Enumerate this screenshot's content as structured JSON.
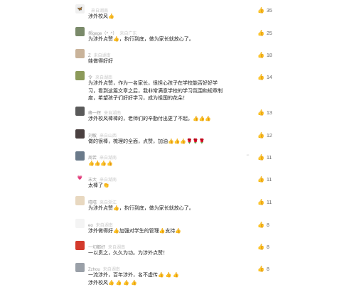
{
  "comments": [
    {
      "avatar": "avatar-butterfly",
      "avatar_color": "#f0f0f0",
      "avatar_icon": "🦋",
      "username": "",
      "location": "来自湖南",
      "text": "涉外校风👍",
      "likes": "35"
    },
    {
      "avatar": "avatar-person",
      "avatar_color": "#7a8a6a",
      "avatar_icon": "",
      "username": "郝gege（^_^）",
      "location": "来自广东",
      "text": "为涉外点赞👍，执行到底，做为家长就放心了。",
      "likes": "25"
    },
    {
      "avatar": "avatar-baby",
      "avatar_color": "#c9b39a",
      "avatar_icon": "",
      "username": "Z",
      "location": "来自湖南",
      "text": "娃做得好好",
      "likes": "18"
    },
    {
      "avatar": "avatar-flower",
      "avatar_color": "#8c9a5a",
      "avatar_icon": "",
      "username": "令",
      "location": "来自湖南",
      "text": "为涉外点赞，作为一名家长，很担心孩子在学校能否好好学习，看到这篇文章之后，我非常满意学校的学习氛围和规章制度，希望孩子们好好学习，成为祖国的花朵！",
      "likes": "14"
    },
    {
      "avatar": "avatar-man",
      "avatar_color": "#5a5a5a",
      "avatar_icon": "",
      "username": "峰一辉",
      "location": "来自湖南",
      "text": "涉外校风棒棒的，老师们的辛勤付出更了不起。👍👍👍",
      "likes": "13"
    },
    {
      "avatar": "avatar-woman",
      "avatar_color": "#4a4040",
      "avatar_icon": "",
      "username": "刘敏",
      "location": "来自山西",
      "text": "做的很棒，梳理的全面，点赞，加油👍👍👍🌹🌹🌹",
      "likes": "12"
    },
    {
      "avatar": "avatar-landscape",
      "avatar_color": "#6a7a8a",
      "avatar_icon": "",
      "username": "周若",
      "location": "来自湖南",
      "text": "👍👍👍👍",
      "likes": "11"
    },
    {
      "avatar": "avatar-heart",
      "avatar_color": "#ffffff",
      "avatar_icon": "💗",
      "username": "末大",
      "location": "来自湖南",
      "text": "太棒了👏",
      "likes": "11"
    },
    {
      "avatar": "avatar-cartoon",
      "avatar_color": "#e8d8c0",
      "avatar_icon": "",
      "username": "嘻嘻",
      "location": "来自浙江",
      "text": "为涉外点赞👍，执行到底，做为家长就放心了。",
      "likes": "11"
    },
    {
      "avatar": "avatar-logo",
      "avatar_color": "#f4f4f4",
      "avatar_icon": "",
      "username": "eo",
      "location": "来自湖南",
      "text": "涉外做得好👍加强对学生的管理👍支持👍",
      "likes": "8"
    },
    {
      "avatar": "avatar-red",
      "avatar_color": "#d33a2c",
      "avatar_icon": "",
      "username": "一切都好",
      "location": "来自湖南",
      "text": "一以贯之，久久为功。为涉外点赞！",
      "likes": "8"
    },
    {
      "avatar": "avatar-photo",
      "avatar_color": "#9aa0a8",
      "avatar_icon": "",
      "username": "Zzhou",
      "location": "来自湖南",
      "text": "一流涉外，百年涉外，名不虚传👍 👍 👍\n涉外校风👍 👍 👍 👍",
      "likes": "8"
    }
  ],
  "icons": {
    "like": "thumbs-up-icon",
    "more": "more-dots-icon"
  },
  "more_label": "···"
}
